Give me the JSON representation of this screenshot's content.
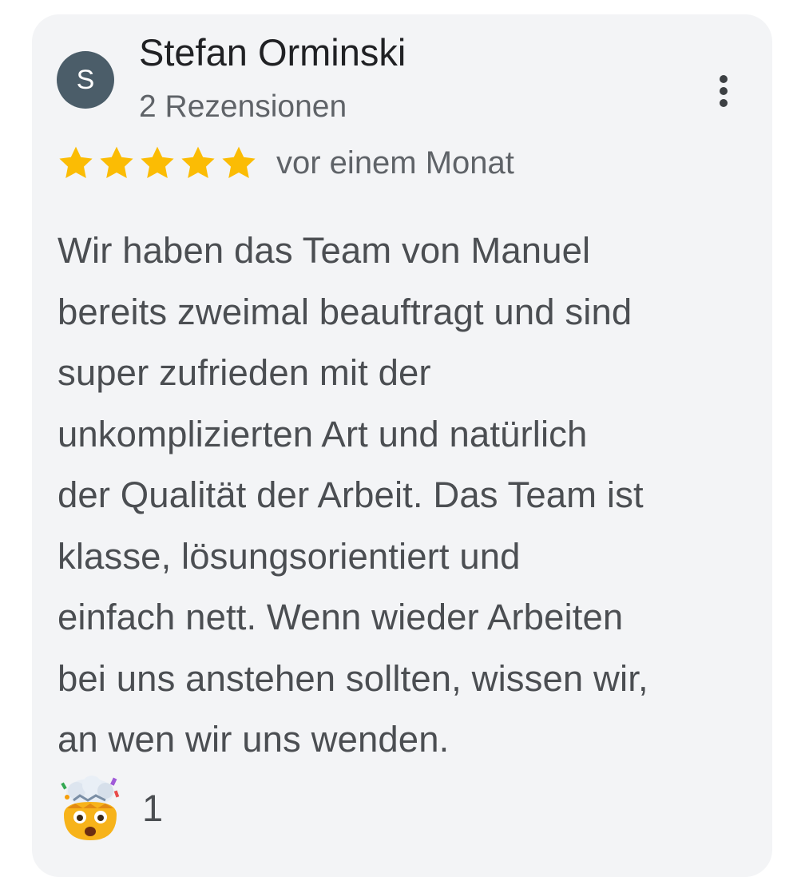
{
  "review": {
    "author": {
      "initial": "S",
      "name": "Stefan Orminski",
      "reviews_label": "2 Rezensionen",
      "avatar_color": "#4b5d69"
    },
    "rating": 5,
    "rating_max": 5,
    "star_color": "#fbbc04",
    "date": "vor einem Monat",
    "lines": [
      "Wir haben das Team von Manuel",
      "bereits zweimal beauftragt und sind",
      "super zufrieden mit der",
      "unkomplizierten Art und natürlich",
      "der Qualität der Arbeit. Das Team ist",
      "klasse, lösungsorientiert und",
      "einfach nett. Wenn wieder Arbeiten",
      "bei uns anstehen sollten, wissen wir,",
      "an wen wir uns wenden."
    ],
    "reaction": {
      "emoji_name": "exploding-head-emoji-icon",
      "count": "1"
    },
    "menu_icon": "more-vertical-icon"
  },
  "colors": {
    "card_background": "#f3f4f6",
    "text_primary": "#202124",
    "text_secondary": "#5f6368",
    "text_body": "#4b4e52"
  }
}
